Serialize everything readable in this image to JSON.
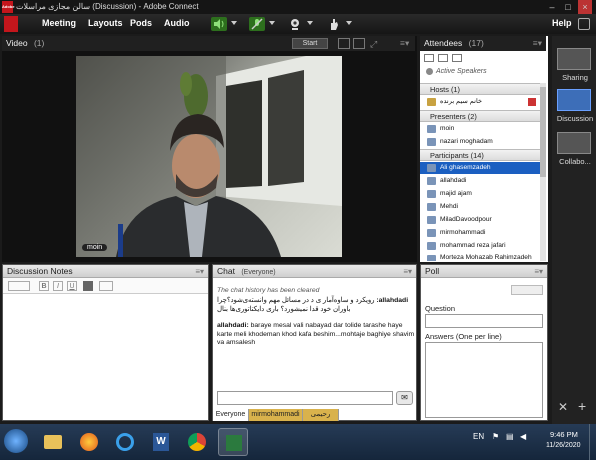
{
  "window": {
    "title": "سالن مجازی مراسلات (Discussion) - Adobe Connect",
    "logo_text": "Adobe"
  },
  "menu": {
    "items": [
      "Meeting",
      "Layouts",
      "Pods",
      "Audio"
    ],
    "help": "Help"
  },
  "video": {
    "title": "Video",
    "count": "(1)",
    "start_label": "Start",
    "name_tag": "moin"
  },
  "attendees": {
    "title": "Attendees",
    "count": "(17)",
    "active_speakers": "Active Speakers",
    "hosts_header": "Hosts (1)",
    "hosts": [
      "خانم سیم برنده"
    ],
    "presenters_header": "Presenters (2)",
    "presenters": [
      "moin",
      "nazari moghadam"
    ],
    "participants_header": "Participants (14)",
    "participants": [
      "Ali ghasemzadeh",
      "allahdadi",
      "majid ajam",
      "Mehdi",
      "MiladDavoodpour",
      "mirmohammadi",
      "mohammad reza jafari",
      "Morteza Mohazab Rahimzadeh"
    ]
  },
  "rail": {
    "items": [
      "Sharing",
      "Discussion",
      "Collabo..."
    ]
  },
  "notes": {
    "title": "Discussion Notes"
  },
  "chat": {
    "title": "Chat",
    "scope": "(Everyone)",
    "history_note": "The chat history has been cleared",
    "messages": [
      {
        "sender": "allahdadi:",
        "text": "رویکرد و ساوه‌آمار ی د در مسائل مهم وانسته‌ی‌شود؟چرا باوران خود قدا نمیشورد؟ باری دایکتاتوری‌ها بنال"
      },
      {
        "sender": "allahdadi:",
        "text": "baraye mesal vali nabayad dar tolide tarashe haye karte meli khodeman khod kafa beshim...mohtaje baghiye shavim va amsalesh"
      }
    ],
    "tabs": [
      "Everyone",
      "mirmohammadi",
      "رحیمی"
    ]
  },
  "poll": {
    "title": "Poll",
    "question_label": "Question",
    "answers_label": "Answers (One per line)"
  },
  "taskbar": {
    "lang": "EN",
    "time": "9:46 PM",
    "date": "11/26/2020"
  },
  "colors": {
    "selection": "#1b5fc1",
    "chrome": "#202020",
    "tab_active": "#d9b24c"
  }
}
